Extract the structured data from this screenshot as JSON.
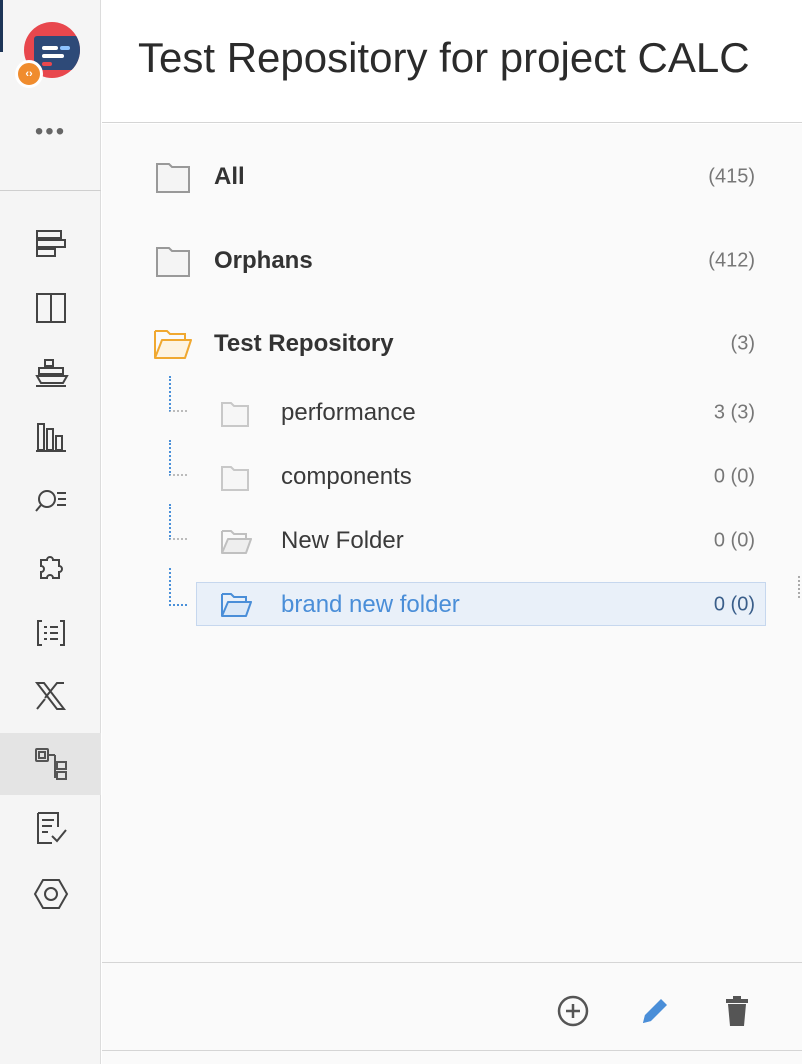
{
  "header": {
    "title": "Test Repository for project CALC"
  },
  "rail": {
    "more_label": "•••",
    "logo_badge": "‹›",
    "items": [
      {
        "icon": "backlog-icon"
      },
      {
        "icon": "board-icon"
      },
      {
        "icon": "ship-icon"
      },
      {
        "icon": "reports-icon"
      },
      {
        "icon": "search-list-icon"
      },
      {
        "icon": "puzzle-icon"
      },
      {
        "icon": "code-list-icon"
      },
      {
        "icon": "x-shuffle-icon"
      },
      {
        "icon": "test-repository-icon",
        "active": true
      },
      {
        "icon": "checklist-icon"
      },
      {
        "icon": "settings-hexagon-icon"
      }
    ]
  },
  "tree": {
    "all": {
      "label": "All",
      "count": "(415)"
    },
    "orphans": {
      "label": "Orphans",
      "count": "(412)"
    },
    "repo": {
      "label": "Test Repository",
      "count": "(3)"
    },
    "children": [
      {
        "label": "performance",
        "count": "3 (3)"
      },
      {
        "label": "components",
        "count": "0 (0)"
      },
      {
        "label": "New Folder",
        "count": "0 (0)"
      },
      {
        "label": "brand new folder",
        "count": "0 (0)",
        "selected": true
      }
    ]
  },
  "colors": {
    "accent": "#4a8ed8",
    "folder_open": "#f0a830",
    "selected_bg": "#e9f0f9"
  },
  "footer": {
    "add_icon": "add-circle-icon",
    "edit_icon": "pencil-icon",
    "delete_icon": "trash-icon"
  }
}
